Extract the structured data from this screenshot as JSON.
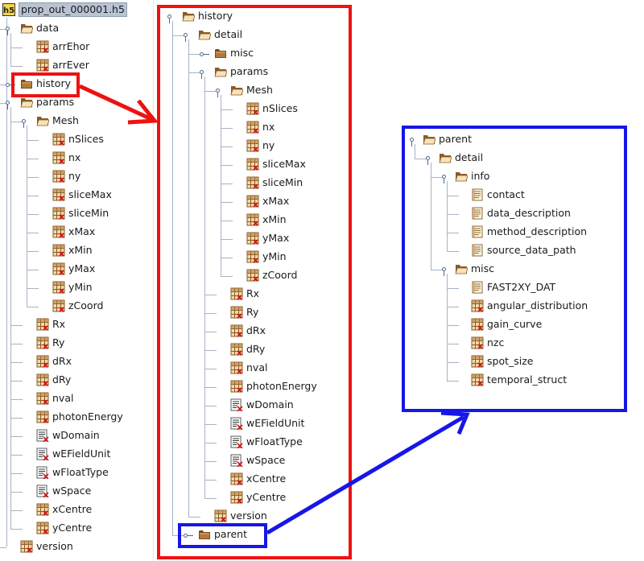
{
  "left_tree": {
    "root": "prop_out_000001.h5",
    "nodes": [
      {
        "label": "data",
        "level": 1,
        "kind": "group",
        "expanded": true
      },
      {
        "label": "arrEhor",
        "level": 2,
        "kind": "dataset"
      },
      {
        "label": "arrEver",
        "level": 2,
        "kind": "dataset"
      },
      {
        "label": "history",
        "level": 1,
        "kind": "group",
        "expanded": false,
        "selected": true
      },
      {
        "label": "params",
        "level": 1,
        "kind": "group",
        "expanded": true
      },
      {
        "label": "Mesh",
        "level": 2,
        "kind": "group",
        "expanded": true
      },
      {
        "label": "nSlices",
        "level": 3,
        "kind": "dataset"
      },
      {
        "label": "nx",
        "level": 3,
        "kind": "dataset"
      },
      {
        "label": "ny",
        "level": 3,
        "kind": "dataset"
      },
      {
        "label": "sliceMax",
        "level": 3,
        "kind": "dataset"
      },
      {
        "label": "sliceMin",
        "level": 3,
        "kind": "dataset"
      },
      {
        "label": "xMax",
        "level": 3,
        "kind": "dataset"
      },
      {
        "label": "xMin",
        "level": 3,
        "kind": "dataset"
      },
      {
        "label": "yMax",
        "level": 3,
        "kind": "dataset"
      },
      {
        "label": "yMin",
        "level": 3,
        "kind": "dataset"
      },
      {
        "label": "zCoord",
        "level": 3,
        "kind": "dataset"
      },
      {
        "label": "Rx",
        "level": 2,
        "kind": "dataset"
      },
      {
        "label": "Ry",
        "level": 2,
        "kind": "dataset"
      },
      {
        "label": "dRx",
        "level": 2,
        "kind": "dataset"
      },
      {
        "label": "dRy",
        "level": 2,
        "kind": "dataset"
      },
      {
        "label": "nval",
        "level": 2,
        "kind": "dataset"
      },
      {
        "label": "photonEnergy",
        "level": 2,
        "kind": "dataset"
      },
      {
        "label": "wDomain",
        "level": 2,
        "kind": "string"
      },
      {
        "label": "wEFieldUnit",
        "level": 2,
        "kind": "string"
      },
      {
        "label": "wFloatType",
        "level": 2,
        "kind": "string"
      },
      {
        "label": "wSpace",
        "level": 2,
        "kind": "string"
      },
      {
        "label": "xCentre",
        "level": 2,
        "kind": "dataset"
      },
      {
        "label": "yCentre",
        "level": 2,
        "kind": "dataset"
      },
      {
        "label": "version",
        "level": 1,
        "kind": "dataset"
      }
    ]
  },
  "middle_tree": {
    "nodes": [
      {
        "label": "history",
        "level": 0,
        "kind": "group",
        "expanded": true
      },
      {
        "label": "detail",
        "level": 1,
        "kind": "group",
        "expanded": true
      },
      {
        "label": "misc",
        "level": 2,
        "kind": "group",
        "expanded": false
      },
      {
        "label": "params",
        "level": 2,
        "kind": "group",
        "expanded": true
      },
      {
        "label": "Mesh",
        "level": 3,
        "kind": "group",
        "expanded": true
      },
      {
        "label": "nSlices",
        "level": 4,
        "kind": "dataset"
      },
      {
        "label": "nx",
        "level": 4,
        "kind": "dataset"
      },
      {
        "label": "ny",
        "level": 4,
        "kind": "dataset"
      },
      {
        "label": "sliceMax",
        "level": 4,
        "kind": "dataset"
      },
      {
        "label": "sliceMin",
        "level": 4,
        "kind": "dataset"
      },
      {
        "label": "xMax",
        "level": 4,
        "kind": "dataset"
      },
      {
        "label": "xMin",
        "level": 4,
        "kind": "dataset"
      },
      {
        "label": "yMax",
        "level": 4,
        "kind": "dataset"
      },
      {
        "label": "yMin",
        "level": 4,
        "kind": "dataset"
      },
      {
        "label": "zCoord",
        "level": 4,
        "kind": "dataset"
      },
      {
        "label": "Rx",
        "level": 3,
        "kind": "dataset"
      },
      {
        "label": "Ry",
        "level": 3,
        "kind": "dataset"
      },
      {
        "label": "dRx",
        "level": 3,
        "kind": "dataset"
      },
      {
        "label": "dRy",
        "level": 3,
        "kind": "dataset"
      },
      {
        "label": "nval",
        "level": 3,
        "kind": "dataset"
      },
      {
        "label": "photonEnergy",
        "level": 3,
        "kind": "dataset"
      },
      {
        "label": "wDomain",
        "level": 3,
        "kind": "string"
      },
      {
        "label": "wEFieldUnit",
        "level": 3,
        "kind": "string"
      },
      {
        "label": "wFloatType",
        "level": 3,
        "kind": "string"
      },
      {
        "label": "wSpace",
        "level": 3,
        "kind": "string"
      },
      {
        "label": "xCentre",
        "level": 3,
        "kind": "dataset"
      },
      {
        "label": "yCentre",
        "level": 3,
        "kind": "dataset"
      },
      {
        "label": "version",
        "level": 2,
        "kind": "dataset"
      },
      {
        "label": "parent",
        "level": 1,
        "kind": "group",
        "expanded": false,
        "selected": true
      }
    ]
  },
  "right_tree": {
    "nodes": [
      {
        "label": "parent",
        "level": 0,
        "kind": "group",
        "expanded": true
      },
      {
        "label": "detail",
        "level": 1,
        "kind": "group",
        "expanded": true
      },
      {
        "label": "info",
        "level": 2,
        "kind": "group",
        "expanded": true
      },
      {
        "label": "contact",
        "level": 3,
        "kind": "text"
      },
      {
        "label": "data_description",
        "level": 3,
        "kind": "text"
      },
      {
        "label": "method_description",
        "level": 3,
        "kind": "text"
      },
      {
        "label": "source_data_path",
        "level": 3,
        "kind": "text"
      },
      {
        "label": "misc",
        "level": 2,
        "kind": "group",
        "expanded": true
      },
      {
        "label": "FAST2XY_DAT",
        "level": 3,
        "kind": "text"
      },
      {
        "label": "angular_distribution",
        "level": 3,
        "kind": "dataset"
      },
      {
        "label": "gain_curve",
        "level": 3,
        "kind": "dataset"
      },
      {
        "label": "nzc",
        "level": 3,
        "kind": "dataset"
      },
      {
        "label": "spot_size",
        "level": 3,
        "kind": "dataset"
      },
      {
        "label": "temporal_struct",
        "level": 3,
        "kind": "dataset"
      }
    ]
  },
  "icons": {
    "group": "folder-icon",
    "dataset": "dataset-grid-icon",
    "string": "string-dataset-icon",
    "text": "text-attribute-icon",
    "file": "h5-file-icon",
    "handle": "tree-expand-handle-icon"
  },
  "colors": {
    "highlight_red": "#ee1111",
    "highlight_blue": "#1616e8",
    "tree_line": "#a7b2c4",
    "selection": "#b9c4d3"
  }
}
